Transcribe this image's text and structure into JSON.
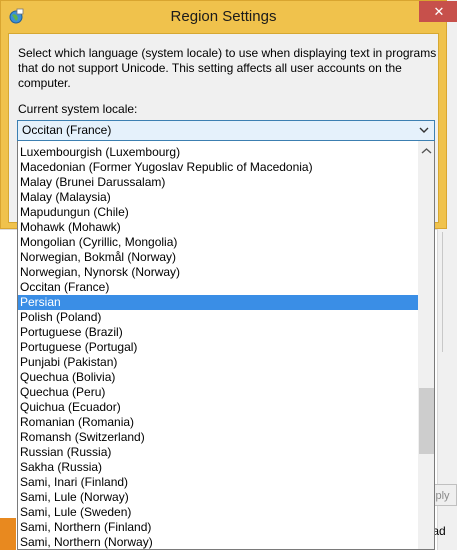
{
  "dialog": {
    "title": "Region Settings",
    "close_icon": "close-icon",
    "description": "Select which language (system locale) to use when displaying text in programs that do not support Unicode. This setting affects all user accounts on the computer.",
    "locale_label": "Current system locale:",
    "current_locale": "Occitan (France)"
  },
  "dropdown": {
    "selected_index": 10,
    "items": [
      "Luxembourgish (Luxembourg)",
      "Macedonian (Former Yugoslav Republic of Macedonia)",
      "Malay (Brunei Darussalam)",
      "Malay (Malaysia)",
      "Mapudungun (Chile)",
      "Mohawk (Mohawk)",
      "Mongolian (Cyrillic, Mongolia)",
      "Norwegian, Bokmål (Norway)",
      "Norwegian, Nynorsk (Norway)",
      "Occitan (France)",
      "Persian",
      "Polish (Poland)",
      "Portuguese (Brazil)",
      "Portuguese (Portugal)",
      "Punjabi (Pakistan)",
      "Quechua (Bolivia)",
      "Quechua (Peru)",
      "Quichua (Ecuador)",
      "Romanian (Romania)",
      "Romansh (Switzerland)",
      "Russian (Russia)",
      "Sakha (Russia)",
      "Sami, Inari (Finland)",
      "Sami, Lule (Norway)",
      "Sami, Lule (Sweden)",
      "Sami, Northern (Finland)",
      "Sami, Northern (Norway)"
    ]
  },
  "background": {
    "apply_label": "Apply",
    "load_label": "load"
  },
  "colors": {
    "frame": "#f0c24c",
    "close": "#c7504b",
    "selection": "#3a8ee6",
    "select_bg": "#e5f1fb"
  }
}
